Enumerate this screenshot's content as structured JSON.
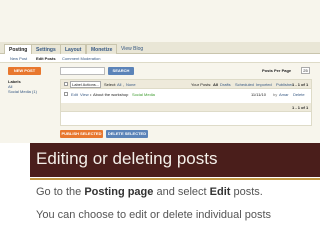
{
  "tabs": [
    {
      "label": "Posting"
    },
    {
      "label": "Settings"
    },
    {
      "label": "Layout"
    },
    {
      "label": "Monetize"
    },
    {
      "label": "View Blog"
    }
  ],
  "subtabs": [
    {
      "label": "New Post"
    },
    {
      "label": "Edit Posts"
    },
    {
      "label": "Comment Moderation"
    }
  ],
  "toolbar": {
    "new_post": "NEW POST",
    "search": "SEARCH",
    "posts_per_page_label": "Posts Per Page",
    "posts_per_page_value": "25"
  },
  "sidebar": {
    "title": "Labels",
    "items": [
      "All",
      "Social Media (1)"
    ]
  },
  "list": {
    "label_actions": "Label Actions...",
    "select": "Select:",
    "select_all": "All",
    "select_comma": ",",
    "select_none": "None",
    "your_posts": "Your Posts:",
    "filter_all": "All",
    "filter_drafts": "Drafts",
    "filter_scheduled": "Scheduled",
    "filter_imported": "Imported",
    "filter_published": "Published",
    "pager": "1 - 1 of 1",
    "pager_bottom": "1 - 1 of 1"
  },
  "post": {
    "edit": "Edit",
    "view": "View",
    "title": "About the workshop",
    "label": "Social Media",
    "date": "11/11/10",
    "by": "by",
    "author": "Amar",
    "delete": "Delete"
  },
  "actions": {
    "publish": "PUBLISH SELECTED",
    "delete": "DELETE SELECTED"
  },
  "slide": {
    "title": "Editing or deleting posts",
    "line1_pre": "Go to the",
    "line1_bold1": "Posting page",
    "line1_mid": "and select",
    "line1_bold2": "Edit",
    "line1_post": "posts.",
    "line2": "You can choose to edit or delete individual posts"
  },
  "colors": {
    "title_band": "#4a1e1b",
    "accent_gold": "#c29944",
    "orange_button": "#e8772e",
    "blue_button": "#5b83b8",
    "link": "#355782"
  }
}
